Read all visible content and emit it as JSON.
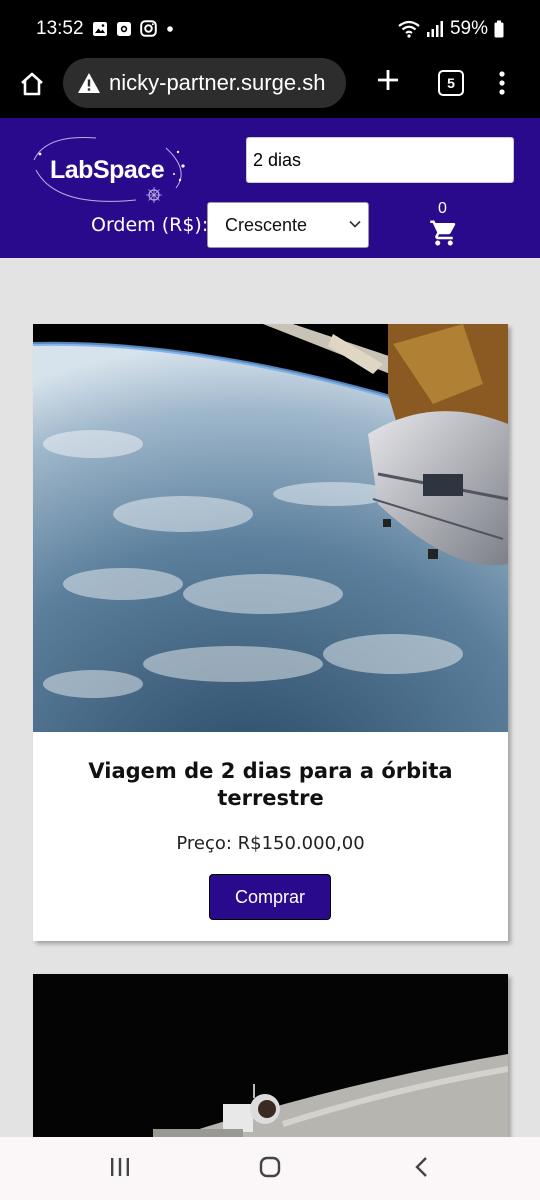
{
  "status_bar": {
    "time": "13:52",
    "battery": "59%",
    "notification_icons": [
      "gallery-icon",
      "voicemail-icon",
      "instagram-icon",
      "dot-icon"
    ],
    "system_icons": [
      "wifi-icon",
      "signal-icon",
      "battery-icon"
    ]
  },
  "browser": {
    "url": "nicky-partner.surge.sh",
    "tab_count": "5"
  },
  "site": {
    "logo_text": "LabSpace",
    "search_value": "2 dias",
    "order_label": "Ordem (R$):",
    "order_selected": "Crescente",
    "cart_count": "0"
  },
  "products": [
    {
      "title": "Viagem de 2 dias para a órbita terrestre",
      "price": "Preço: R$150.000,00",
      "buy_label": "Comprar"
    }
  ],
  "colors": {
    "brand_purple": "#2a0a8c",
    "page_background": "#e3e3e3"
  }
}
